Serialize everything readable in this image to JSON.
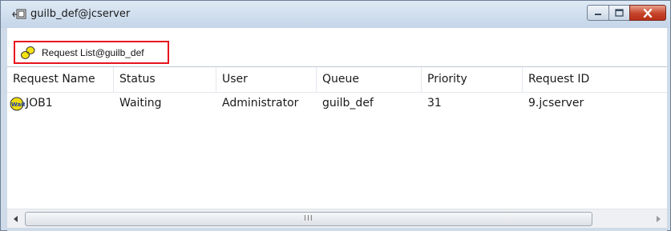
{
  "window": {
    "title": "guilb_def@jcserver",
    "title_icon": "server-queue-icon"
  },
  "tab": {
    "label": "Request List@guilb_def",
    "icon": "request-list-icon",
    "highlight_color": "#e8131f"
  },
  "table": {
    "columns": [
      "Request Name",
      "Status",
      "User",
      "Queue",
      "Priority",
      "Request ID"
    ],
    "rows": [
      {
        "request_name": "JOB1",
        "status": "Waiting",
        "user": "Administrator",
        "queue": "guilb_def",
        "priority": "31",
        "request_id": "9.jcserver",
        "icon": "wait-job-icon"
      }
    ]
  },
  "scrollbar": {
    "grip": "III"
  },
  "colors": {
    "close_button": "#c7432b",
    "window_frame": "#cfdbe8"
  }
}
